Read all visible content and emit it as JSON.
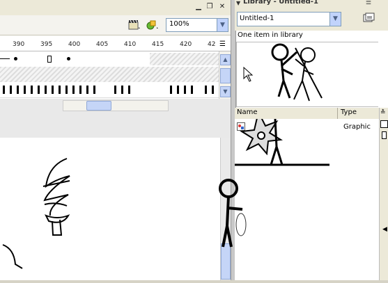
{
  "timeline": {
    "zoom": "100%",
    "frame_labels": [
      "390",
      "395",
      "400",
      "405",
      "410",
      "415",
      "420",
      "42"
    ]
  },
  "library": {
    "title": "Library - Untitled-1",
    "document_select": "Untitled-1",
    "item_count_text": "One item in library",
    "columns": {
      "name": "Name",
      "type": "Type"
    },
    "items": [
      {
        "name": "",
        "type": "Graphic"
      }
    ]
  },
  "colors": {
    "toolbar_bg": "#ece9d8",
    "scroll_blue": "#c5d5f7",
    "select_border": "#7f9db9"
  }
}
